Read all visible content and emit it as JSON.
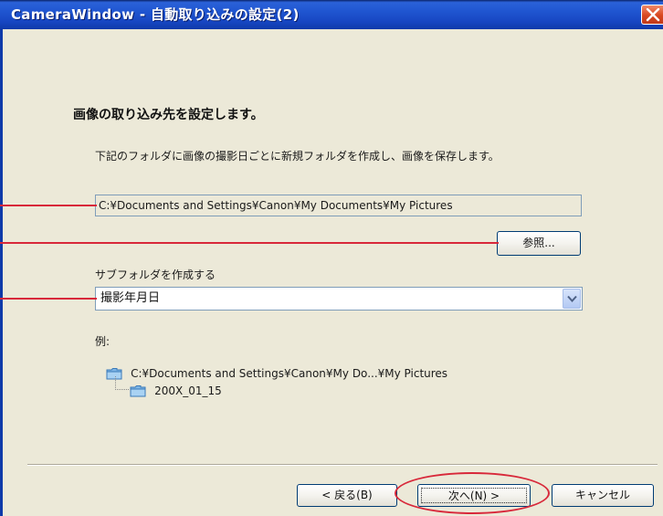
{
  "window": {
    "title": "CameraWindow - 自動取り込みの設定(2)"
  },
  "content": {
    "heading": "画像の取り込み先を設定します。",
    "description": "下記のフォルダに画像の撮影日ごとに新規フォルダを作成し、画像を保存します。",
    "path_value": "C:¥Documents and Settings¥Canon¥My Documents¥My Pictures",
    "browse_label": "参照...",
    "subfolder_label": "サブフォルダを作成する",
    "subfolder_selected": "撮影年月日",
    "example_label": "例:",
    "example_tree": [
      "C:¥Documents and Settings¥Canon¥My Do...¥My Pictures",
      "200X_01_15"
    ]
  },
  "footer": {
    "back_label": "< 戻る(B)",
    "next_label": "次へ(N) >",
    "cancel_label": "キャンセル"
  },
  "colors": {
    "titlebar": "#1f55d0",
    "dialog_bg": "#ECE9D8",
    "callout": "#d8283a"
  },
  "icons": [
    "close-icon",
    "chevron-down-icon",
    "folder-icon"
  ]
}
